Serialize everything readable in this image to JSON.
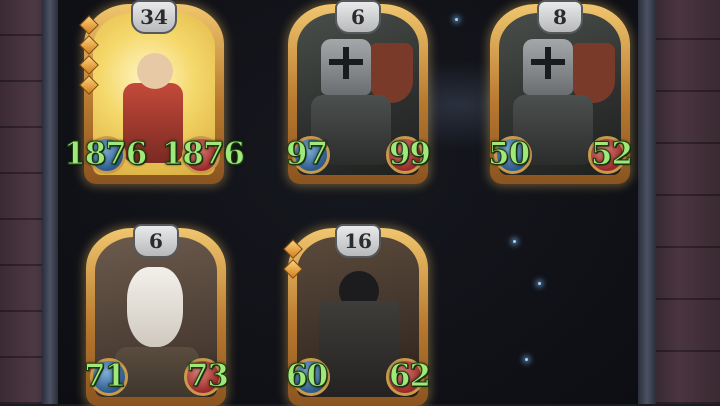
{
  "cards": [
    {
      "id": "hero",
      "cost": "34",
      "attack": "1876",
      "health": "1876",
      "gems": 4,
      "art": "hero"
    },
    {
      "id": "crusader-1",
      "cost": "6",
      "attack": "97",
      "health": "99",
      "gems": 0,
      "art": "crusader"
    },
    {
      "id": "crusader-2",
      "cost": "8",
      "attack": "50",
      "health": "52",
      "gems": 0,
      "art": "crusader"
    },
    {
      "id": "goat",
      "cost": "6",
      "attack": "71",
      "health": "73",
      "gems": 0,
      "art": "goat"
    },
    {
      "id": "shieldbearer",
      "cost": "16",
      "attack": "60",
      "health": "62",
      "gems": 2,
      "art": "shield"
    }
  ],
  "colors": {
    "frame_gold": "#d9a04a",
    "stat_green": "#9fe87a",
    "attack_orb": "#2d5a8a",
    "health_orb": "#9a2a2a"
  }
}
